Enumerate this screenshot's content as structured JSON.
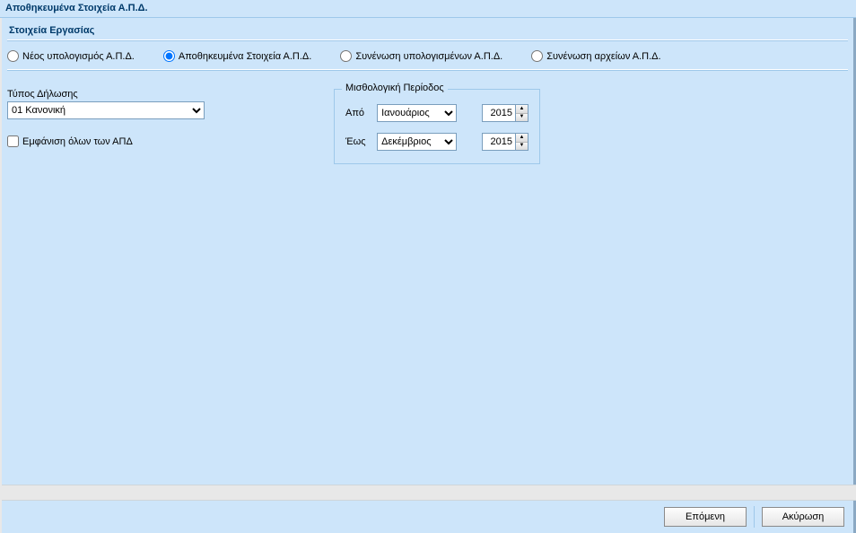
{
  "title": "Αποθηκευμένα Στοιχεία Α.Π.Δ.",
  "section_header": "Στοιχεία Εργασίας",
  "radios": {
    "new_calc": "Νέος υπολογισμός Α.Π.Δ.",
    "saved_data": "Αποθηκευμένα Στοιχεία Α.Π.Δ.",
    "merge_calcs": "Συνένωση υπολογισμένων Α.Π.Δ.",
    "merge_files": "Συνένωση αρχείων Α.Π.Δ.",
    "selected": "saved_data"
  },
  "declaration_type": {
    "label": "Τύπος Δήλωσης",
    "value": "01 Κανονική"
  },
  "show_all_apd": {
    "label": "Εμφάνιση όλων των ΑΠΔ",
    "checked": false
  },
  "period": {
    "legend": "Μισθολογική Περίοδος",
    "from_label": "Από",
    "to_label": "Έως",
    "from_month": "Ιανουάριος",
    "to_month": "Δεκέμβριος",
    "from_year": "2015",
    "to_year": "2015"
  },
  "buttons": {
    "next": "Επόμενη",
    "cancel": "Ακύρωση"
  },
  "icons": {
    "spin_up": "▲",
    "spin_down": "▼"
  }
}
